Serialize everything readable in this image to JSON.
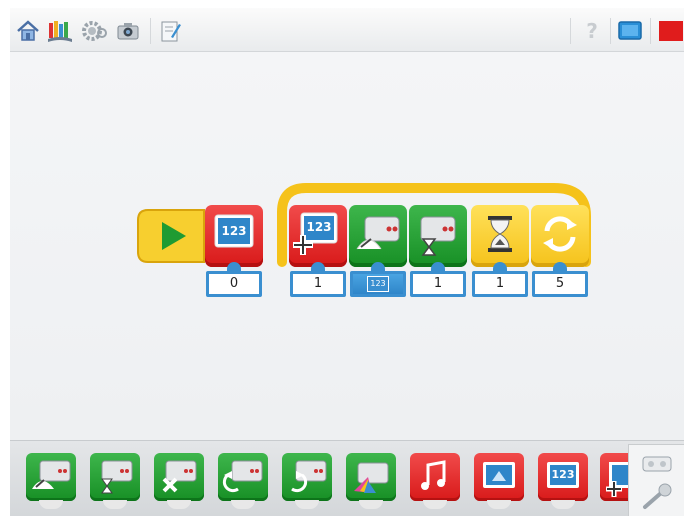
{
  "toolbar": {
    "left_tools": [
      "home-icon",
      "library-icon",
      "gear-icon",
      "camera-icon",
      "notes-icon"
    ],
    "right_tools": [
      "help-icon",
      "display-icon",
      "stop-icon"
    ],
    "help_label": "?"
  },
  "program": {
    "blocks": [
      {
        "type": "start",
        "icon": "play-icon",
        "color": "yellow"
      },
      {
        "type": "display-number",
        "icon": "display-icon",
        "color": "red",
        "value": "0",
        "label": "123"
      },
      {
        "type": "display-add",
        "icon": "display-add-icon",
        "color": "red",
        "value": "1",
        "label": "123"
      },
      {
        "type": "motor-power",
        "icon": "motor-power-icon",
        "color": "green",
        "input": "123"
      },
      {
        "type": "motor-on-for",
        "icon": "motor-timer-icon",
        "color": "green",
        "value": "1"
      },
      {
        "type": "wait",
        "icon": "hourglass-icon",
        "color": "yellow",
        "value": "1"
      },
      {
        "type": "repeat",
        "icon": "loop-icon",
        "color": "yellow",
        "value": "5"
      }
    ]
  },
  "palette": {
    "items": [
      {
        "name": "motor-power-icon",
        "color": "green"
      },
      {
        "name": "motor-timer-icon",
        "color": "green"
      },
      {
        "name": "motor-off-icon",
        "color": "green"
      },
      {
        "name": "motor-ccw-icon",
        "color": "green"
      },
      {
        "name": "motor-cw-icon",
        "color": "green"
      },
      {
        "name": "motor-light-icon",
        "color": "green"
      },
      {
        "name": "sound-icon",
        "color": "red"
      },
      {
        "name": "display-background-icon",
        "color": "red"
      },
      {
        "name": "display-number-icon",
        "color": "red",
        "label": "123"
      },
      {
        "name": "display-add-icon",
        "color": "red"
      }
    ],
    "side": [
      "tilt-sensor-icon",
      "microphone-icon"
    ]
  },
  "colors": {
    "red": "#e32727",
    "green": "#22a030",
    "yellow": "#f7cf2f",
    "blue": "#3a8fd0",
    "loop": "#f5c21a"
  }
}
